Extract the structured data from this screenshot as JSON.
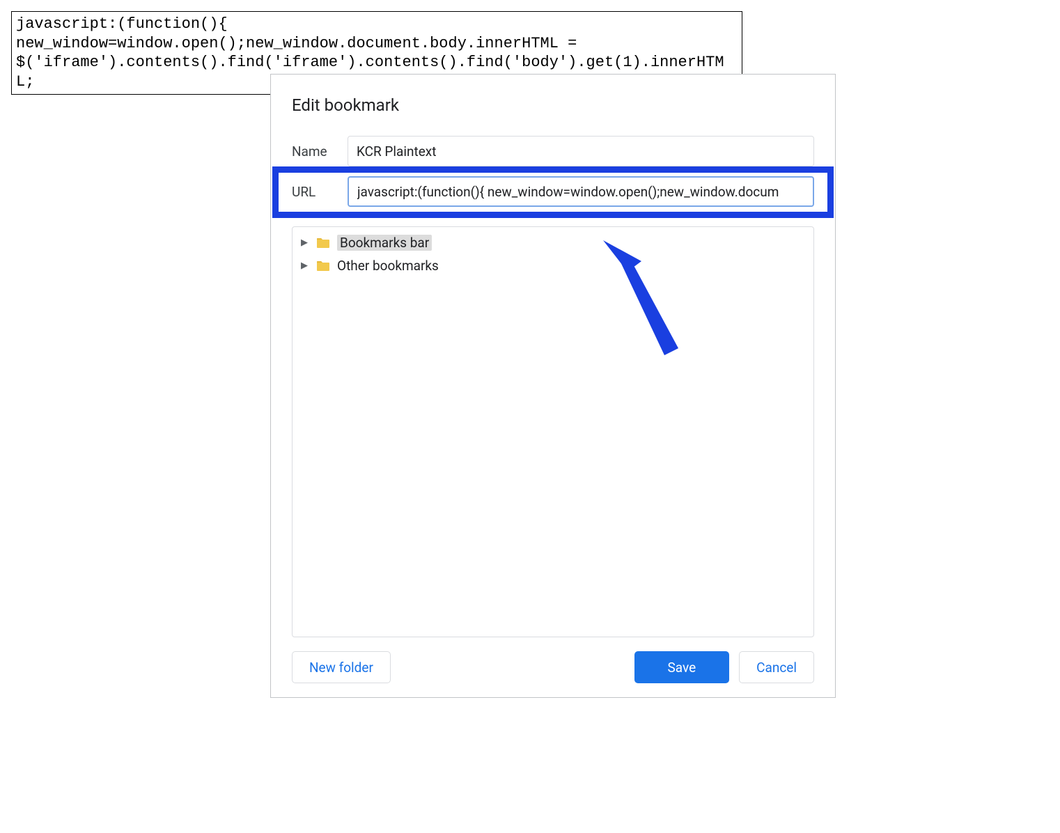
{
  "code_snippet": "javascript:(function(){\nnew_window=window.open();new_window.document.body.innerHTML =\n$('iframe').contents().find('iframe').contents().find('body').get(1).innerHTML;",
  "dialog": {
    "title": "Edit bookmark",
    "name_label": "Name",
    "name_value": "KCR Plaintext",
    "url_label": "URL",
    "url_value": "javascript:(function(){ new_window=window.open();new_window.docum",
    "tree": {
      "items": [
        {
          "label": "Bookmarks bar",
          "selected": true
        },
        {
          "label": "Other bookmarks",
          "selected": false
        }
      ]
    },
    "actions": {
      "new_folder": "New folder",
      "save": "Save",
      "cancel": "Cancel"
    }
  },
  "annotation": {
    "highlight_color": "#1a3fe0"
  }
}
